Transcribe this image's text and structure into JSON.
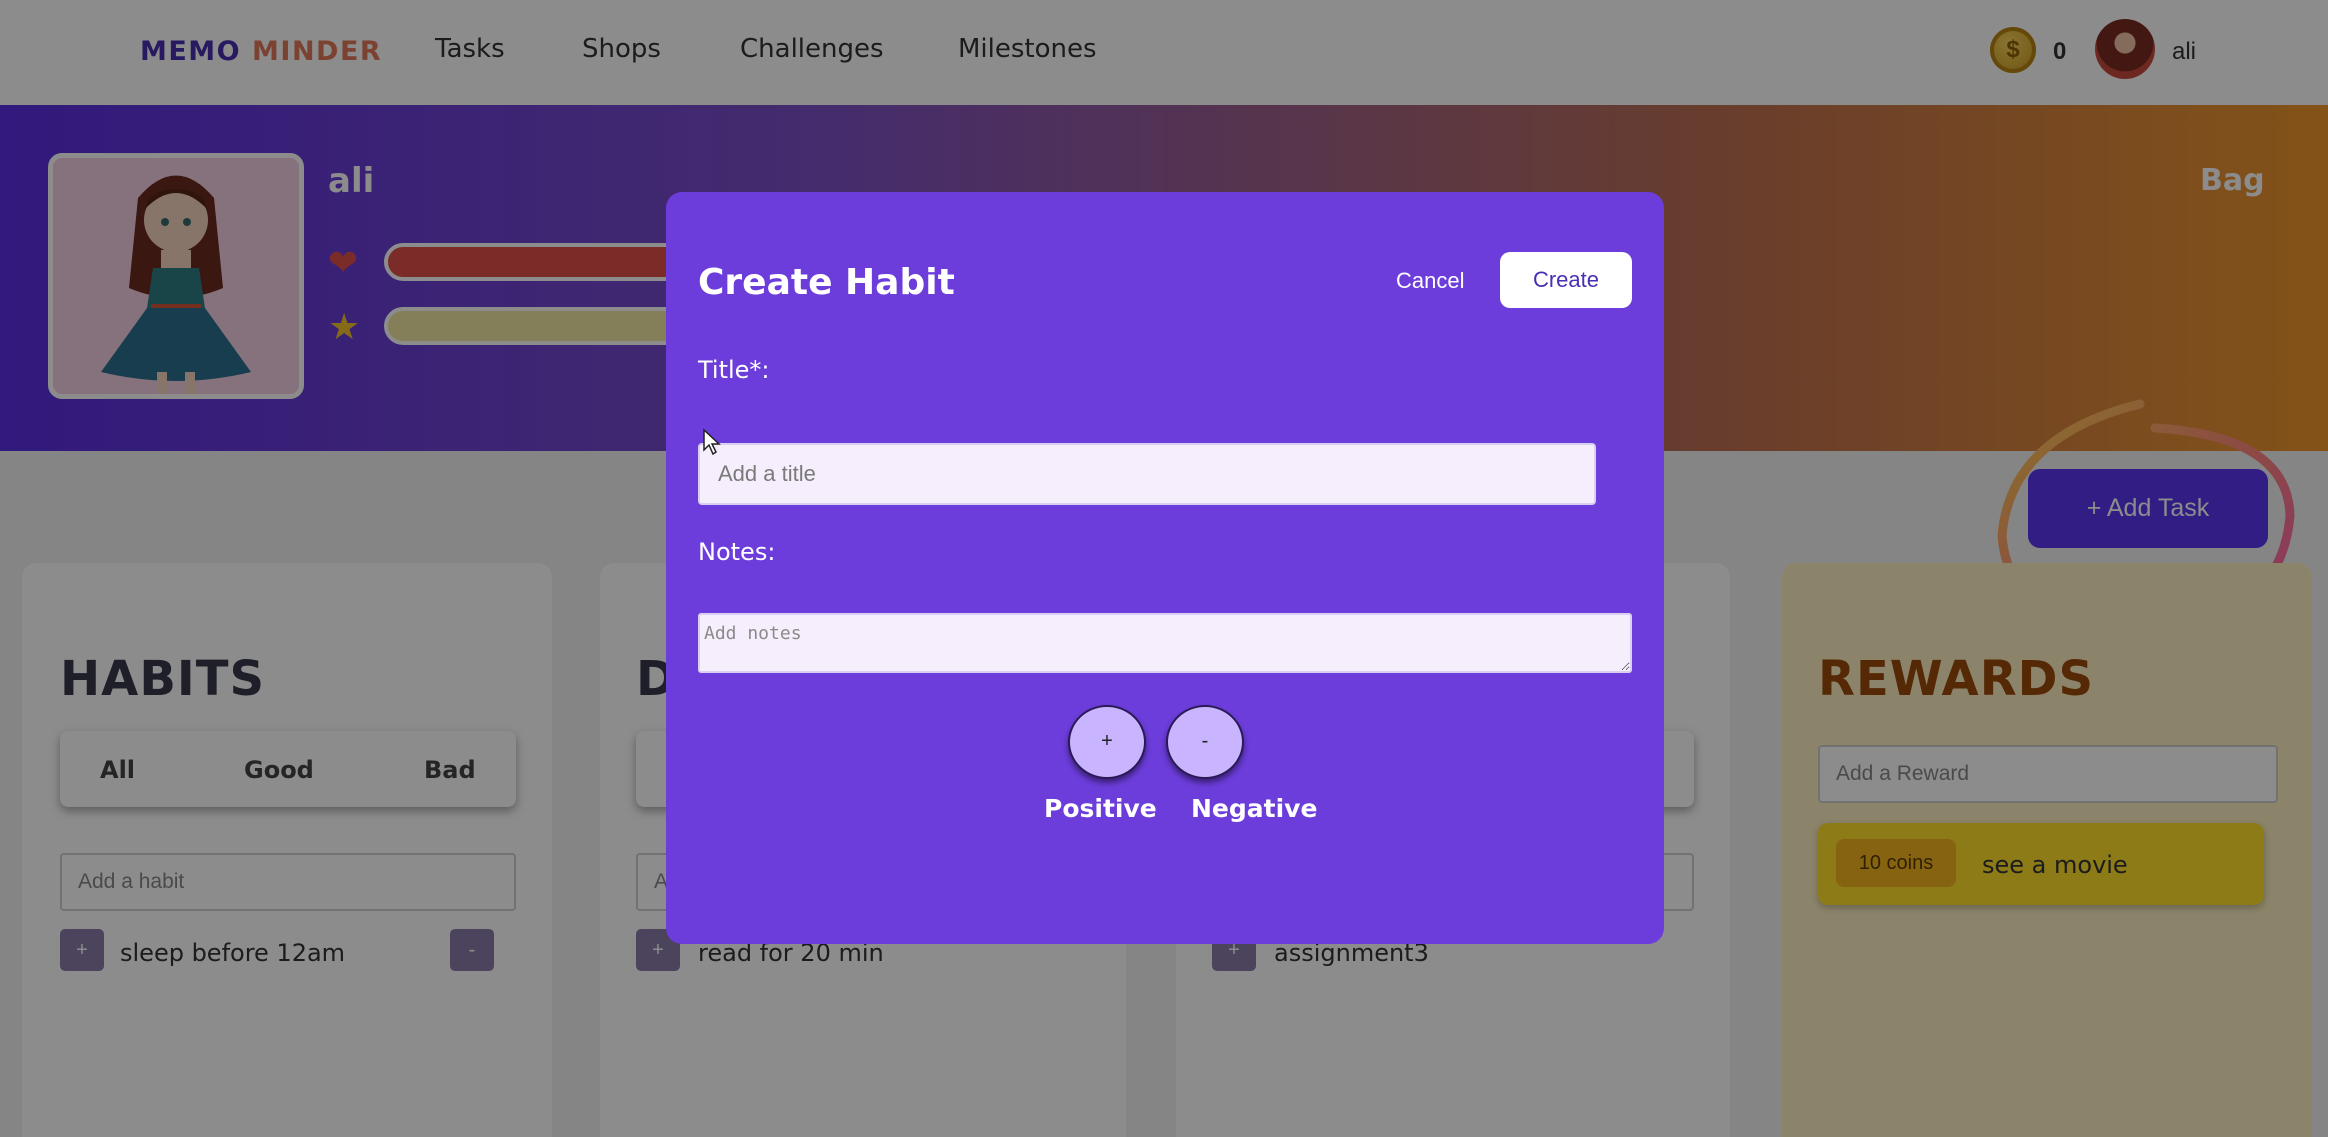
{
  "nav": {
    "logo_part1": "MEMO",
    "logo_part2": "MINDER",
    "links": [
      "Tasks",
      "Shops",
      "Challenges",
      "Milestones"
    ],
    "coin_symbol": "$",
    "coins": "0",
    "username": "ali"
  },
  "hero": {
    "name": "ali",
    "health_icon": "heart-icon",
    "experience_icon": "star-icon",
    "bag_label": "Bag",
    "health_color": "#e0504a",
    "experience_color": "#f2e7a3"
  },
  "add_task_label": "+ Add Task",
  "columns": {
    "habits": {
      "title": "HABITS",
      "filters": [
        "All",
        "Good",
        "Bad"
      ],
      "input_placeholder": "Add a habit",
      "items": [
        {
          "text": "sleep before 12am",
          "plus": "+",
          "minus": "-"
        }
      ]
    },
    "dailies": {
      "title": "D",
      "input_placeholder": "A",
      "items": [
        {
          "text": "read for 20 min",
          "plus": "+"
        }
      ]
    },
    "todos": {
      "items": [
        {
          "text": "assignment3",
          "plus": "+"
        }
      ]
    },
    "rewards": {
      "title": "REWARDS",
      "input_placeholder": "Add a Reward",
      "items": [
        {
          "price": "10 coins",
          "text": "see a movie"
        }
      ]
    }
  },
  "modal": {
    "title": "Create Habit",
    "cancel_label": "Cancel",
    "create_label": "Create",
    "title_label": "Title*:",
    "title_placeholder": "Add a title",
    "notes_label": "Notes:",
    "notes_placeholder": "Add notes",
    "positive_symbol": "+",
    "negative_symbol": "-",
    "positive_label": "Positive",
    "negative_label": "Negative"
  },
  "colors": {
    "brand_purple": "#4a2fb0",
    "modal_bg": "#6c3ddb",
    "accent_orange": "#e0795a"
  }
}
